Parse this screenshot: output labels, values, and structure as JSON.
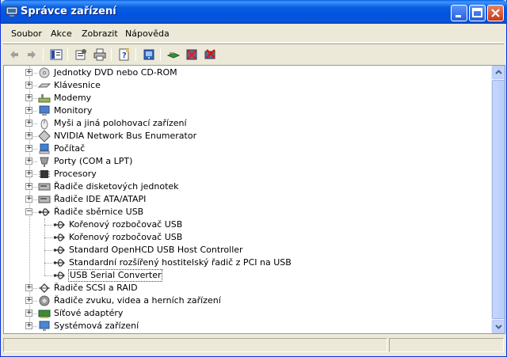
{
  "window": {
    "title": "Správce zařízení",
    "colors": {
      "titlebar": "#0054E3",
      "chrome": "#ECE9D8",
      "selection_border": "#444444"
    }
  },
  "menu": [
    "Soubor",
    "Akce",
    "Zobrazit",
    "Nápověda"
  ],
  "toolbar": {
    "icons": [
      "back-arrow-icon",
      "forward-arrow-icon",
      "show-hide-tree-icon",
      "properties-icon",
      "print-icon",
      "help-icon",
      "scan-hardware-icon",
      "update-driver-icon",
      "disable-device-icon",
      "uninstall-device-icon"
    ]
  },
  "tree": {
    "items": [
      {
        "label": "Jednotky DVD nebo CD-ROM",
        "icon": "dvd-drive-icon",
        "expander": "+"
      },
      {
        "label": "Klávesnice",
        "icon": "keyboard-icon",
        "expander": "+"
      },
      {
        "label": "Modemy",
        "icon": "modem-icon",
        "expander": "+"
      },
      {
        "label": "Monitory",
        "icon": "monitor-icon",
        "expander": "+"
      },
      {
        "label": "Myši a jiná polohovací zařízení",
        "icon": "mouse-icon",
        "expander": "+"
      },
      {
        "label": "NVIDIA Network Bus Enumerator",
        "icon": "network-bus-icon",
        "expander": "+"
      },
      {
        "label": "Počítač",
        "icon": "computer-icon",
        "expander": "+"
      },
      {
        "label": "Porty (COM a LPT)",
        "icon": "port-icon",
        "expander": "+"
      },
      {
        "label": "Procesory",
        "icon": "processor-icon",
        "expander": "+"
      },
      {
        "label": "Řadiče disketových jednotek",
        "icon": "floppy-controller-icon",
        "expander": "+"
      },
      {
        "label": "Řadiče IDE ATA/ATAPI",
        "icon": "ide-controller-icon",
        "expander": "+"
      },
      {
        "label": "Řadiče sběrnice USB",
        "icon": "usb-icon",
        "expander": "−"
      },
      {
        "label": "Kořenový rozbočovač USB",
        "icon": "usb-icon",
        "child": true
      },
      {
        "label": "Kořenový rozbočovač USB",
        "icon": "usb-icon",
        "child": true
      },
      {
        "label": "Standard OpenHCD USB Host Controller",
        "icon": "usb-icon",
        "child": true
      },
      {
        "label": "Standardní rozšířený hostitelský řadič z PCI na USB",
        "icon": "usb-icon",
        "child": true
      },
      {
        "label": "USB Serial Converter",
        "icon": "usb-icon",
        "child": true,
        "selected": true
      },
      {
        "label": "Řadiče SCSI a RAID",
        "icon": "scsi-controller-icon",
        "expander": "+"
      },
      {
        "label": "Řadiče zvuku, videa a herních zařízení",
        "icon": "sound-icon",
        "expander": "+"
      },
      {
        "label": "Síťové adaptéry",
        "icon": "network-adapter-icon",
        "expander": "+"
      },
      {
        "label": "Systémová zařízení",
        "icon": "system-device-icon",
        "expander": "+"
      }
    ]
  },
  "statusbar": {
    "text": ""
  }
}
